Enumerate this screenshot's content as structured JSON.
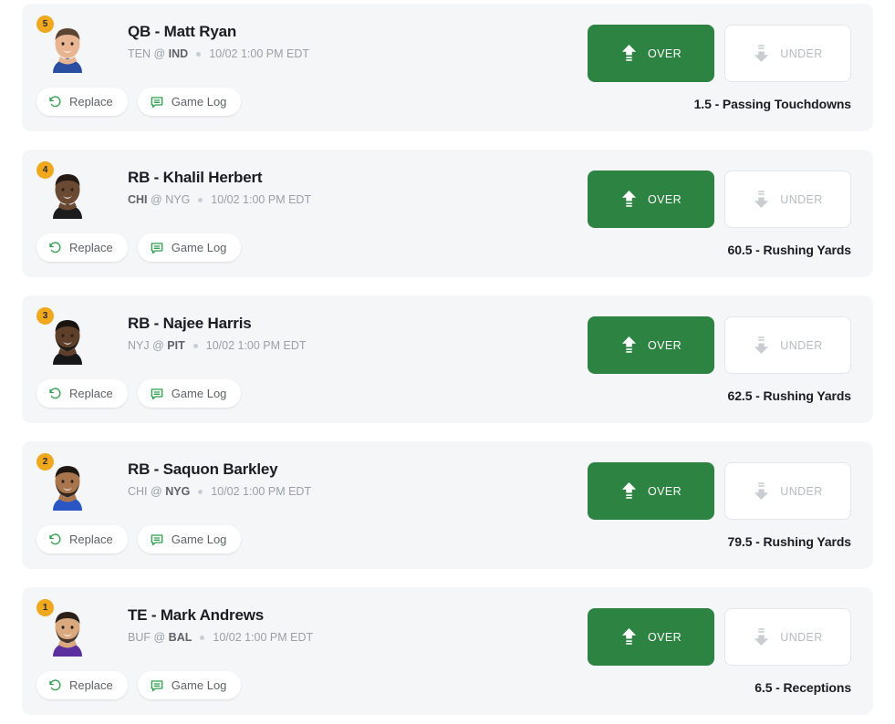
{
  "buttons": {
    "replace_label": "Replace",
    "game_log_label": "Game Log",
    "over_label": "OVER",
    "under_label": "UNDER"
  },
  "colors": {
    "over_green": "#2d8341",
    "accent_green": "#2e9e4f",
    "badge_gold": "#f0a81e",
    "card_bg": "#f4f6f8",
    "under_gray": "#b6bcc2"
  },
  "icons": {
    "replace": "rotate-ccw-icon",
    "game_log": "message-lines-icon",
    "over": "arrow-up-lines-icon",
    "under": "arrow-down-lines-icon"
  },
  "picks": [
    {
      "badge": "5",
      "name": "QB - Matt Ryan",
      "away_team": "TEN",
      "at": "@",
      "home_team": "IND",
      "bold_team": "home",
      "kickoff": "10/02 1:00 PM EDT",
      "line": "1.5 - Passing Touchdowns",
      "selection": "OVER"
    },
    {
      "badge": "4",
      "name": "RB - Khalil Herbert",
      "away_team": "CHI",
      "at": "@",
      "home_team": "NYG",
      "bold_team": "away",
      "kickoff": "10/02 1:00 PM EDT",
      "line": "60.5 - Rushing Yards",
      "selection": "OVER"
    },
    {
      "badge": "3",
      "name": "RB - Najee Harris",
      "away_team": "NYJ",
      "at": "@",
      "home_team": "PIT",
      "bold_team": "home",
      "kickoff": "10/02 1:00 PM EDT",
      "line": "62.5 - Rushing Yards",
      "selection": "OVER"
    },
    {
      "badge": "2",
      "name": "RB - Saquon Barkley",
      "away_team": "CHI",
      "at": "@",
      "home_team": "NYG",
      "bold_team": "home",
      "kickoff": "10/02 1:00 PM EDT",
      "line": "79.5 - Rushing Yards",
      "selection": "OVER"
    },
    {
      "badge": "1",
      "name": "TE - Mark Andrews",
      "away_team": "BUF",
      "at": "@",
      "home_team": "BAL",
      "bold_team": "home",
      "kickoff": "10/02 1:00 PM EDT",
      "line": "6.5 - Receptions",
      "selection": "OVER"
    }
  ]
}
